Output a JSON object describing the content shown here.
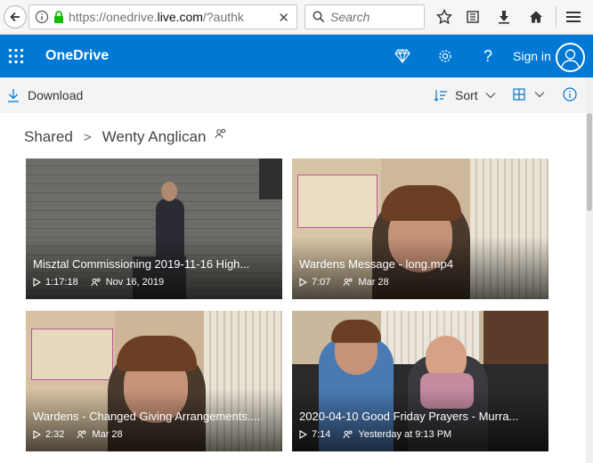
{
  "browser": {
    "url_prefix": "https://onedrive.",
    "url_domain": "live.com",
    "url_suffix": "/?authk",
    "search_placeholder": "Search"
  },
  "header": {
    "app_title": "OneDrive",
    "sign_in": "Sign in"
  },
  "command_bar": {
    "download": "Download",
    "sort": "Sort"
  },
  "breadcrumb": {
    "root": "Shared",
    "current": "Wenty Anglican"
  },
  "colors": {
    "accent": "#0078d4"
  },
  "tiles": [
    {
      "name": "Misztal Commissioning 2019-11-16 High...",
      "duration": "1:17:18",
      "date": "Nov 16, 2019"
    },
    {
      "name": "Wardens Message - long.mp4",
      "duration": "7:07",
      "date": "Mar 28"
    },
    {
      "name": "Wardens - Changed Giving Arrangements....",
      "duration": "2:32",
      "date": "Mar 28"
    },
    {
      "name": "2020-04-10 Good Friday Prayers - Murra...",
      "duration": "7:14",
      "date": "Yesterday at 9:13 PM"
    }
  ]
}
